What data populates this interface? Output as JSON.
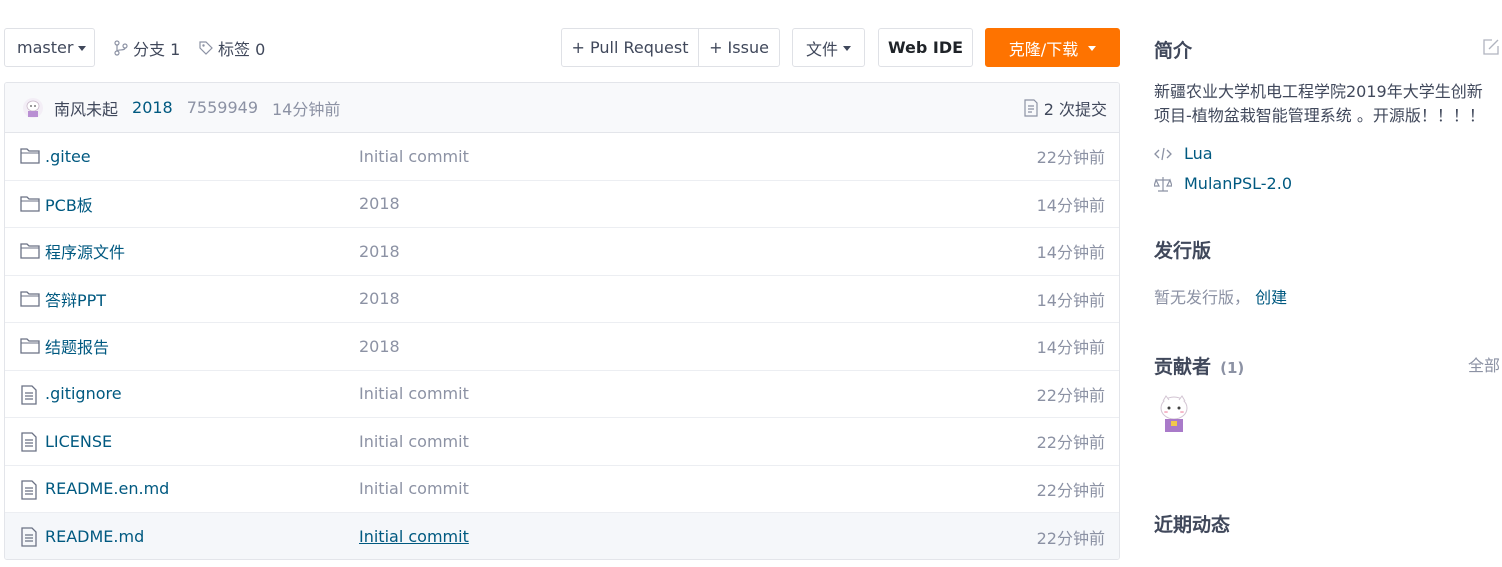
{
  "toolbar": {
    "branch": "master",
    "branches_label": "分支 1",
    "tags_label": "标签 0",
    "pull_request": "+ Pull Request",
    "issue": "+ Issue",
    "file": "文件",
    "web_ide": "Web IDE",
    "clone": "克隆/下载"
  },
  "commit": {
    "author": "南风未起",
    "message": "2018",
    "sha": "7559949",
    "time": "14分钟前",
    "count": "2 次提交"
  },
  "files": [
    {
      "type": "folder",
      "name": ".gitee",
      "message": "Initial commit",
      "time": "22分钟前"
    },
    {
      "type": "folder",
      "name": "PCB板",
      "message": "2018",
      "time": "14分钟前"
    },
    {
      "type": "folder",
      "name": "程序源文件",
      "message": "2018",
      "time": "14分钟前"
    },
    {
      "type": "folder",
      "name": "答辩PPT",
      "message": "2018",
      "time": "14分钟前"
    },
    {
      "type": "folder",
      "name": "结题报告",
      "message": "2018",
      "time": "14分钟前"
    },
    {
      "type": "file",
      "name": ".gitignore",
      "message": "Initial commit",
      "time": "22分钟前"
    },
    {
      "type": "file",
      "name": "LICENSE",
      "message": "Initial commit",
      "time": "22分钟前"
    },
    {
      "type": "file",
      "name": "README.en.md",
      "message": "Initial commit",
      "time": "22分钟前"
    },
    {
      "type": "file",
      "name": "README.md",
      "message": "Initial commit",
      "time": "22分钟前"
    }
  ],
  "sidebar": {
    "intro_title": "简介",
    "description": "新疆农业大学机电工程学院2019年大学生创新项目-植物盆栽智能管理系统 。开源版！！！！",
    "language": "Lua",
    "license": "MulanPSL-2.0",
    "releases_title": "发行版",
    "no_release": "暂无发行版，",
    "create_link": "创建",
    "contributors_title": "贡献者",
    "contributors_count": "(1)",
    "all_link": "全部",
    "activity_title": "近期动态"
  },
  "colors": {
    "accent": "#fe7300",
    "link": "#005980",
    "muted": "#8c92a4"
  }
}
